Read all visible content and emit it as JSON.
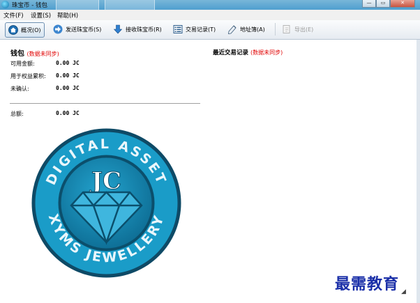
{
  "window": {
    "title": "珠宝币 - 钱包"
  },
  "menu": [
    {
      "label": "文件(F)"
    },
    {
      "label": "设置(S)"
    },
    {
      "label": "帮助(H)"
    }
  ],
  "toolbar": {
    "overview": "概况(O)",
    "send": "发送珠宝币(S)",
    "receive": "接收珠宝币(R)",
    "transactions": "交易记录(T)",
    "addressbook": "地址簿(A)",
    "export": "导出(E)"
  },
  "wallet": {
    "title": "钱包",
    "sync_status": "(数据未同步)",
    "rows": [
      {
        "label": "可用金额:",
        "value": "0.00 JC"
      },
      {
        "label": "用于权益累积:",
        "value": "0.00 JC"
      },
      {
        "label": "未确认:",
        "value": "0.00 JC"
      }
    ],
    "total": {
      "label": "总额:",
      "value": "0.00 JC"
    }
  },
  "recent": {
    "title": "最近交易记录",
    "sync_status": "(数据未同步)"
  },
  "logo": {
    "top_text": "DIGITAL ASSET",
    "bottom_text": "XYMS JEWELLERY",
    "monogram": "JC"
  },
  "watermark": "最需教育",
  "colors": {
    "accent": "#1a91b8",
    "dark": "#0b4f6c",
    "warning": "#e00000"
  }
}
